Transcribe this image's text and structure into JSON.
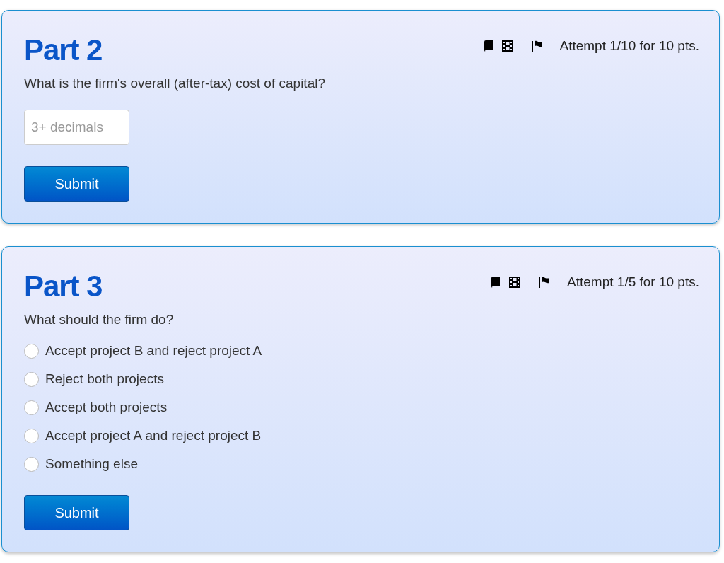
{
  "parts": [
    {
      "kind": "numeric",
      "title": "Part 2",
      "attempt": "Attempt 1/10 for 10 pts.",
      "question": "What is the firm's overall (after-tax) cost of capital?",
      "placeholder": "3+ decimals",
      "submit": "Submit"
    },
    {
      "kind": "choice",
      "title": "Part 3",
      "attempt": "Attempt 1/5 for 10 pts.",
      "question": "What should the firm do?",
      "options": [
        {
          "label": "Accept project B and reject project A",
          "selected": false
        },
        {
          "label": "Reject both projects",
          "selected": false
        },
        {
          "label": "Accept both projects",
          "selected": false
        },
        {
          "label": "Accept project A and reject project B",
          "selected": false
        },
        {
          "label": "Something else",
          "selected": false
        }
      ],
      "submit": "Submit"
    }
  ]
}
